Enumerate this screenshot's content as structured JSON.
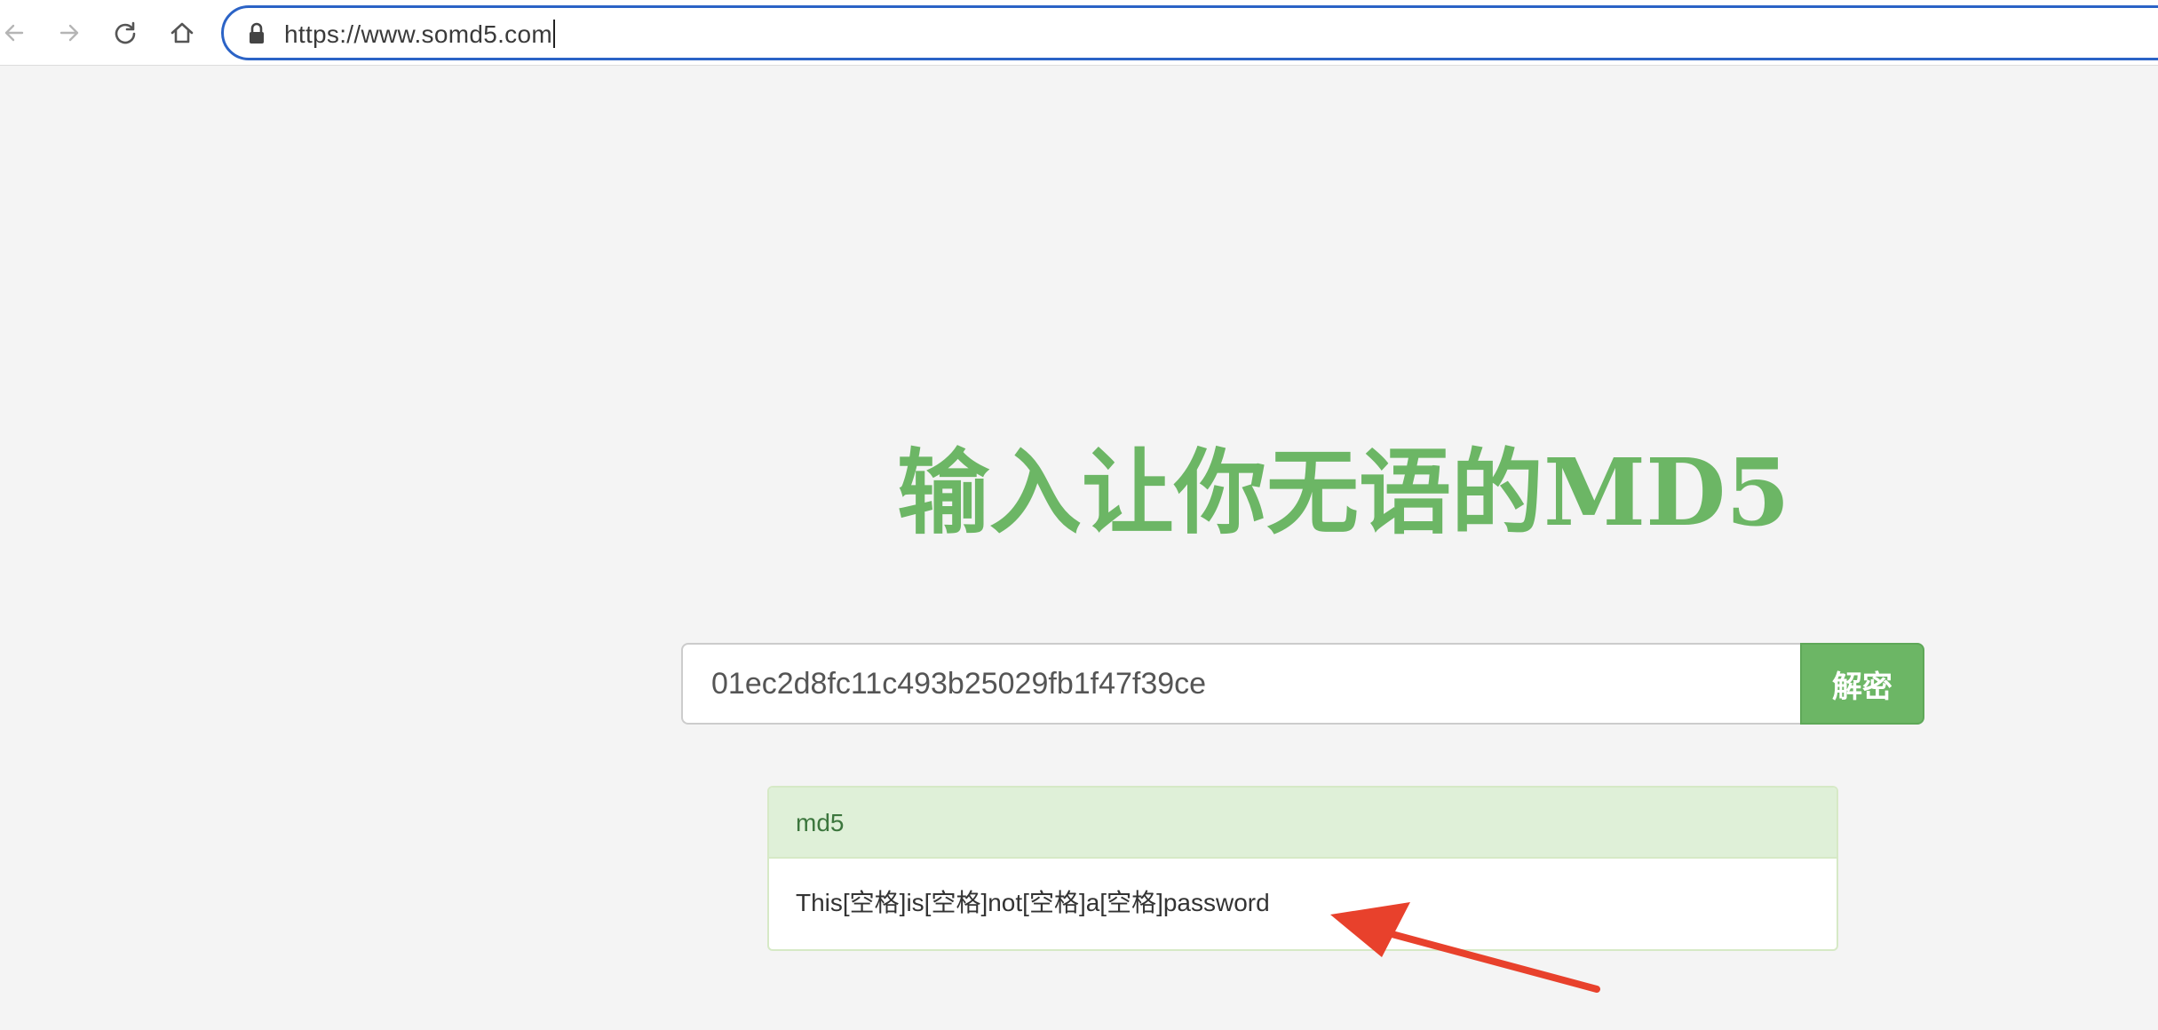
{
  "browser": {
    "url": "https://www.somd5.com",
    "icons": {
      "back": "arrow-left-icon",
      "forward": "arrow-right-icon",
      "reload": "reload-icon",
      "home": "home-icon",
      "lock": "lock-icon"
    }
  },
  "page": {
    "title": "输入让你无语的MD5",
    "search": {
      "value": "01ec2d8fc11c493b25029fb1f47f39ce",
      "button_label": "解密"
    },
    "result": {
      "heading": "md5",
      "body": "This[空格]is[空格]not[空格]a[空格]password"
    }
  },
  "colors": {
    "accent_green": "#6cb665",
    "url_focus_border": "#2b63c6",
    "panel_heading_bg": "#dff0d8",
    "panel_heading_text": "#3c763d",
    "annotation_arrow": "#e8412c",
    "page_bg": "#f4f4f4"
  }
}
